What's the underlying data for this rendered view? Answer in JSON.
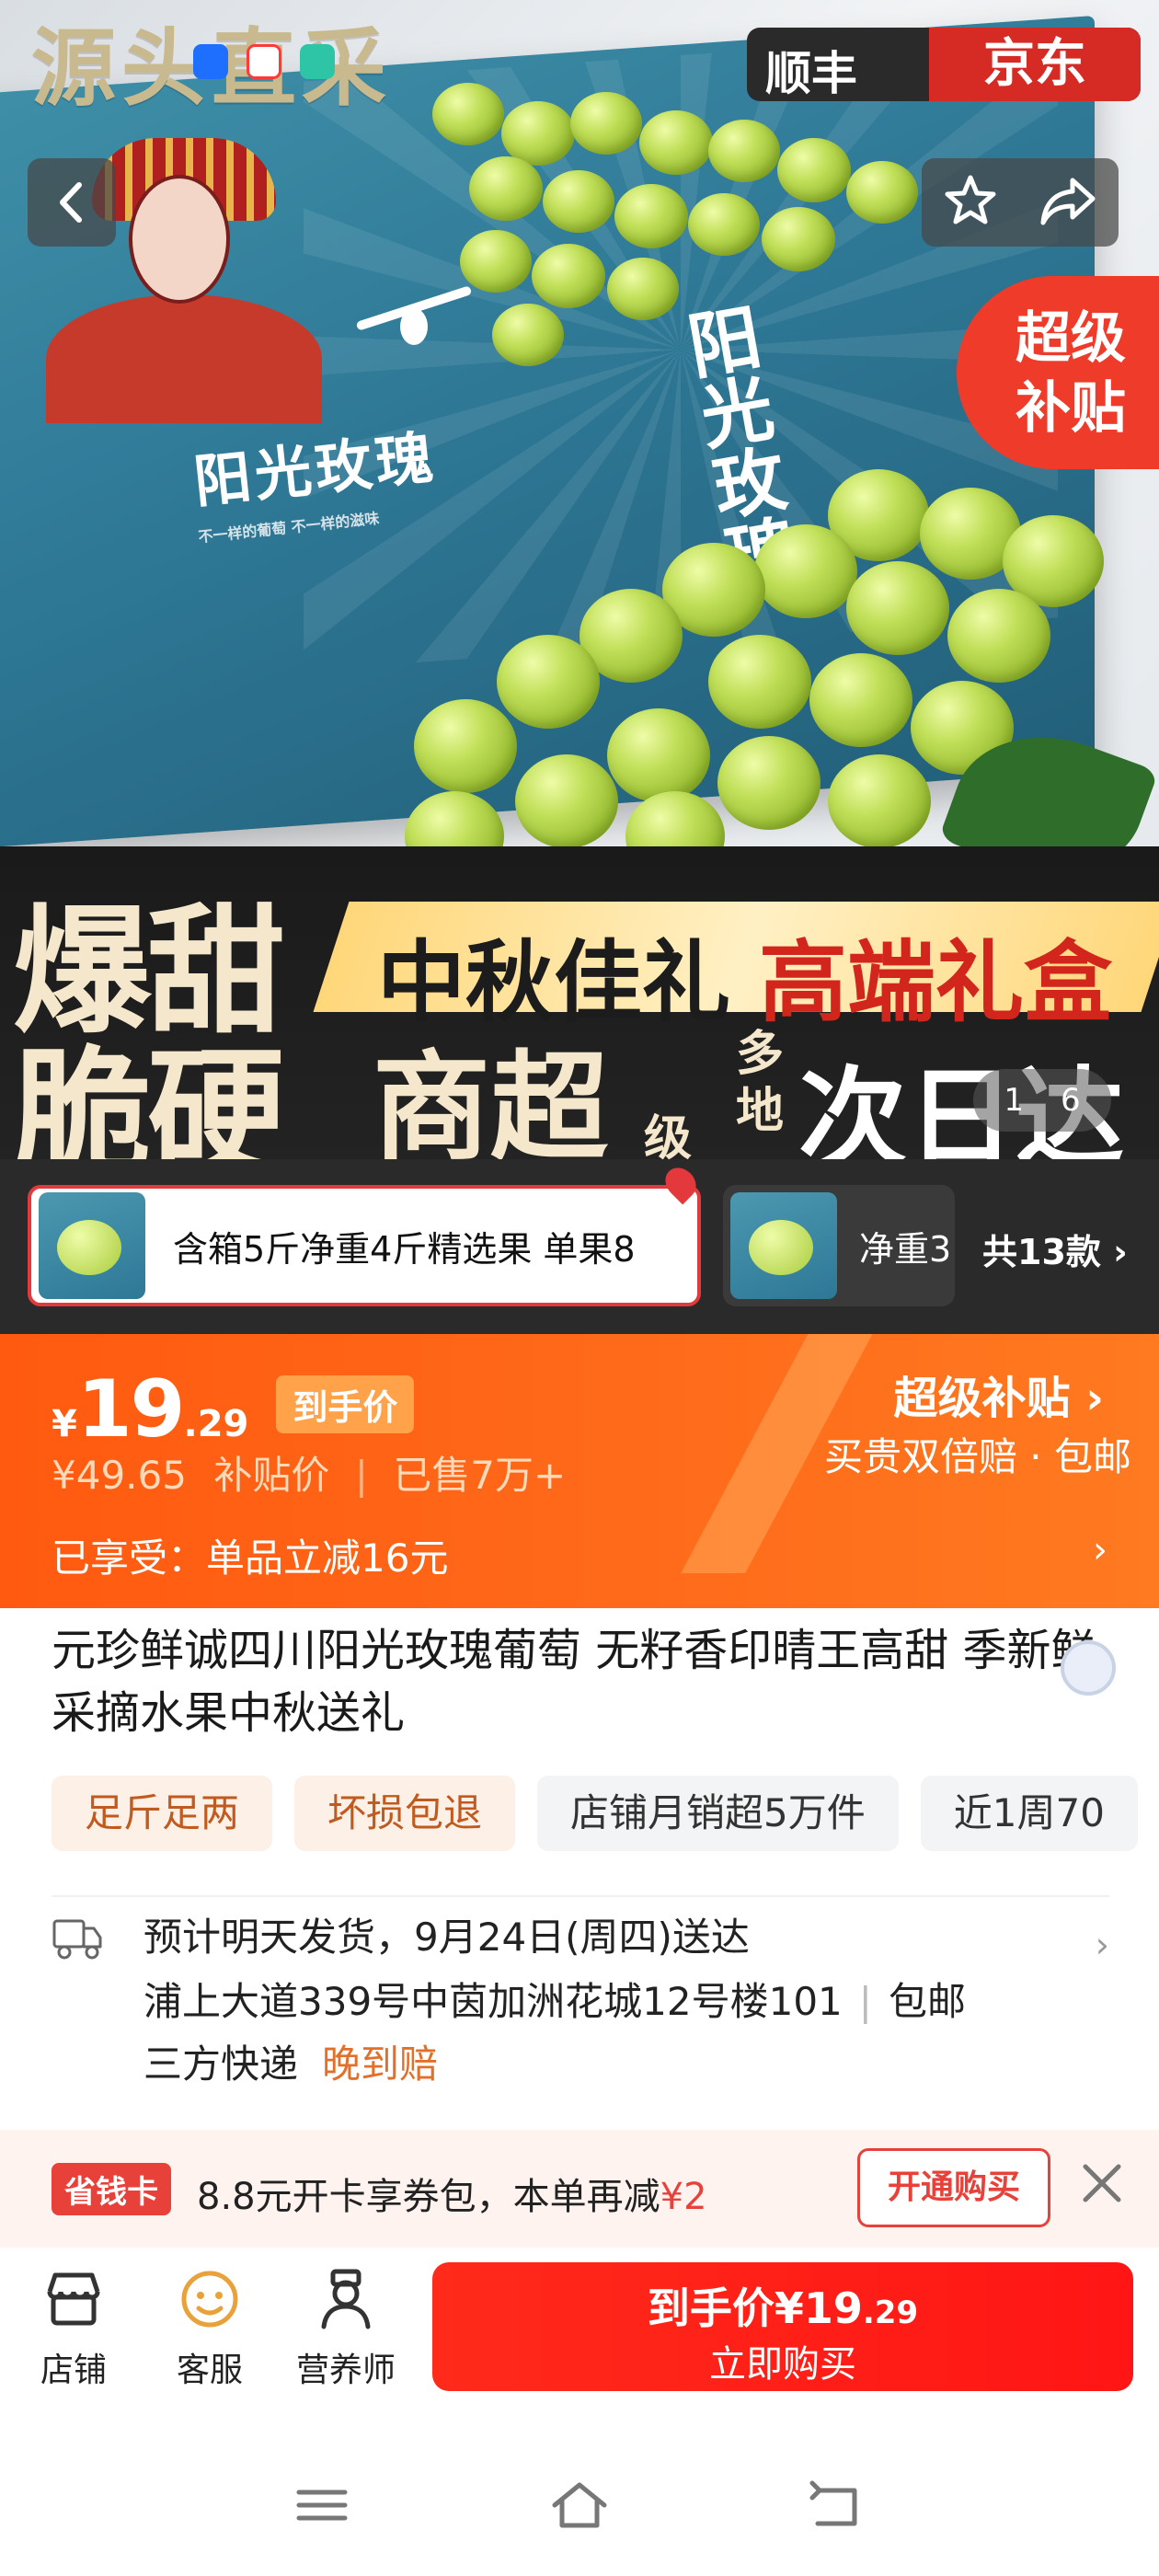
{
  "hero": {
    "top_title": "源头直采",
    "brand_sf": "顺丰",
    "brand_jd": "京东",
    "box_calligraphy": "阳光玫瑰",
    "box_vertical_text": "阳光玫瑰",
    "box_small_text": "不一样的葡萄 不一样的滋味",
    "subsidy_badge_line1": "超级",
    "subsidy_badge_line2": "补贴",
    "icons": {
      "back": "chevron-left-icon",
      "favorite": "star-icon",
      "share": "share-icon"
    }
  },
  "banner": {
    "word1": "爆甜",
    "word2": "脆硬",
    "gift": "中秋佳礼",
    "highend": "高端礼盒",
    "market": "商超",
    "grade": "级",
    "places": "多地",
    "nextday": "次日达",
    "pager_current": "1",
    "pager_total": "6"
  },
  "variants": {
    "selected_label": "含箱5斤净重4斤精选果 单果8",
    "second_label": "净重3",
    "total": "共13款 ›"
  },
  "price": {
    "currency": "¥",
    "int": "19",
    "dec": ".29",
    "final_tag": "到手价",
    "original": "¥49.65",
    "original_label": "补贴价",
    "sold": "已售7万+",
    "super_subsidy": "超级补贴 ›",
    "guarantee": "买贵双倍赔 · 包邮",
    "enjoy": "已享受：单品立减16元",
    "enjoy_arrow": "›"
  },
  "product": {
    "title": "元珍鲜诚四川阳光玫瑰葡萄 无籽香印晴王高甜 季新鲜采摘水果中秋送礼",
    "tags": [
      "足斤足两",
      "坏损包退",
      "店铺月销超5万件",
      "近1周70"
    ]
  },
  "delivery": {
    "line1": "预计明天发货，9月24日(周四)送达",
    "address": "浦上大道339号中茵加洲花城12号楼101",
    "free_ship": "包邮",
    "courier": "三方快递",
    "late_comp": "晚到赔",
    "arrow": "›"
  },
  "savings": {
    "tag": "省钱卡",
    "text": "8.8元开卡享券包，本单再减",
    "amount": "¥2",
    "button": "开通购买"
  },
  "actions": {
    "store": "店铺",
    "service": "客服",
    "nutrition": "营养师",
    "buy_line1": "到手价",
    "buy_price": "¥19",
    "buy_price_dec": ".29",
    "buy_line2": "立即购买"
  },
  "colors": {
    "accent": "#ff5a10",
    "buy": "#ff1f14",
    "deal_red": "#e8413a",
    "late_orange": "#e2702b"
  }
}
